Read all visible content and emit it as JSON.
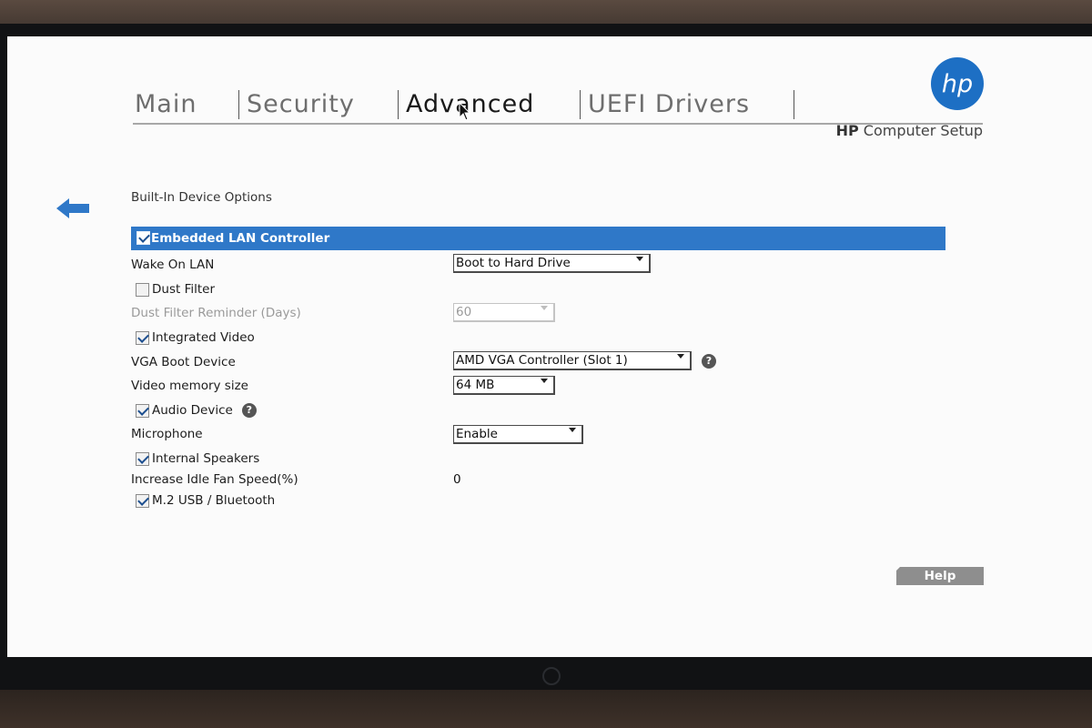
{
  "tabs": [
    {
      "label": "Main",
      "active": false
    },
    {
      "label": "Security",
      "active": false
    },
    {
      "label": "Advanced",
      "active": true
    },
    {
      "label": "UEFI Drivers",
      "active": false
    }
  ],
  "brand": {
    "logo_text": "hp",
    "product_bold": "HP",
    "product_rest": "Computer Setup",
    "color": "#1d6fc4"
  },
  "page": {
    "section_title": "Built-In Device Options",
    "back_icon": "back-arrow-icon"
  },
  "options": {
    "embedded_lan": {
      "label": "Embedded LAN Controller",
      "checked": true,
      "selected": true
    },
    "wake_on_lan": {
      "label": "Wake On LAN",
      "value": "Boot to Hard Drive"
    },
    "dust_filter": {
      "label": "Dust Filter",
      "checked": false
    },
    "dust_filter_reminder": {
      "label": "Dust Filter Reminder (Days)",
      "value": "60",
      "disabled": true
    },
    "integrated_video": {
      "label": "Integrated Video",
      "checked": true
    },
    "vga_boot_device": {
      "label": "VGA Boot Device",
      "value": "AMD VGA Controller (Slot 1)",
      "help_icon": "?"
    },
    "video_memory": {
      "label": "Video memory size",
      "value": "64 MB"
    },
    "audio_device": {
      "label": "Audio Device",
      "checked": true,
      "help_icon": "?"
    },
    "microphone": {
      "label": "Microphone",
      "value": "Enable"
    },
    "internal_speakers": {
      "label": "Internal Speakers",
      "checked": true
    },
    "idle_fan_speed": {
      "label": "Increase Idle Fan Speed(%)",
      "value": "0"
    },
    "m2_usb_bluetooth": {
      "label": "M.2 USB / Bluetooth",
      "checked": true
    }
  },
  "buttons": {
    "help": "Help"
  },
  "colors": {
    "highlight": "#2f78c8",
    "help_button": "#8e8e8e",
    "screen_bg": "#fbfbfb"
  }
}
